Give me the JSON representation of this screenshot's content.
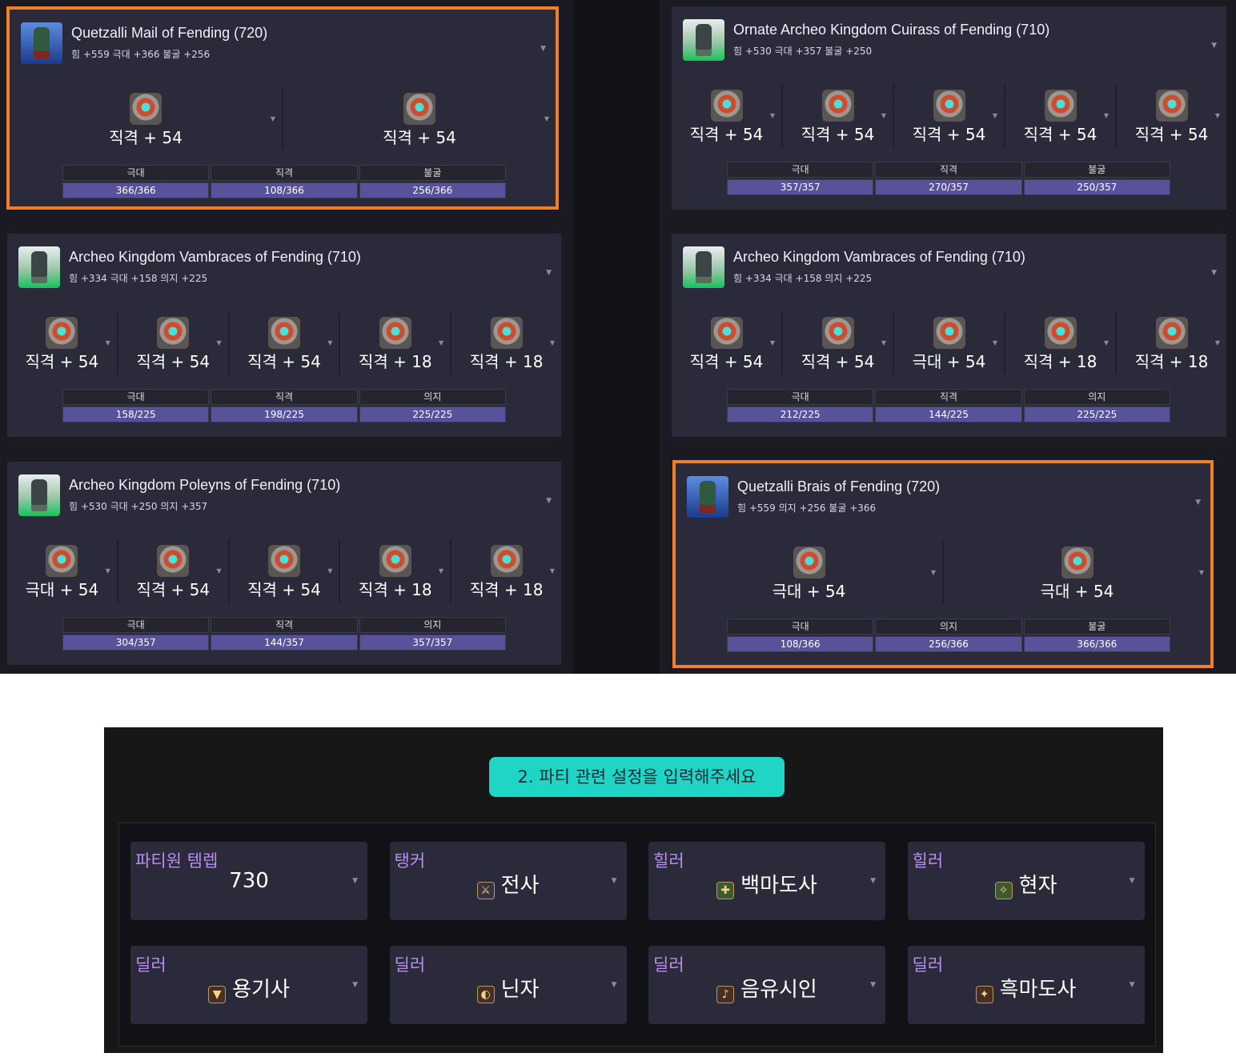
{
  "gear": [
    {
      "name": "Quetzalli Mail of Fending (720)",
      "stats": "힘 +559 극대 +366 불굴 +256",
      "icon": "blue",
      "highlight": true,
      "melds": [
        "직격 + 54",
        "직격 + 54"
      ],
      "table": {
        "headers": [
          "극대",
          "직격",
          "불굴"
        ],
        "values": [
          "366/366",
          "108/366",
          "256/366"
        ]
      }
    },
    {
      "name": "Ornate Archeo Kingdom Cuirass of Fending (710)",
      "stats": "힘 +530 극대 +357 불굴 +250",
      "icon": "green",
      "highlight": false,
      "melds": [
        "직격 + 54",
        "직격 + 54",
        "직격 + 54",
        "직격 + 54",
        "직격 + 54"
      ],
      "table": {
        "headers": [
          "극대",
          "직격",
          "불굴"
        ],
        "values": [
          "357/357",
          "270/357",
          "250/357"
        ]
      }
    },
    {
      "name": "Archeo Kingdom Vambraces of Fending (710)",
      "stats": "힘 +334 극대 +158 의지 +225",
      "icon": "green",
      "highlight": false,
      "melds": [
        "직격 + 54",
        "직격 + 54",
        "직격 + 54",
        "직격 + 18",
        "직격 + 18"
      ],
      "table": {
        "headers": [
          "극대",
          "직격",
          "의지"
        ],
        "values": [
          "158/225",
          "198/225",
          "225/225"
        ]
      }
    },
    {
      "name": "Archeo Kingdom Vambraces of Fending (710)",
      "stats": "힘 +334 극대 +158 의지 +225",
      "icon": "green",
      "highlight": false,
      "melds": [
        "직격 + 54",
        "직격 + 54",
        "극대 + 54",
        "직격 + 18",
        "직격 + 18"
      ],
      "table": {
        "headers": [
          "극대",
          "직격",
          "의지"
        ],
        "values": [
          "212/225",
          "144/225",
          "225/225"
        ]
      }
    },
    {
      "name": "Archeo Kingdom Poleyns of Fending (710)",
      "stats": "힘 +530 극대 +250 의지 +357",
      "icon": "green",
      "highlight": false,
      "melds": [
        "극대 + 54",
        "직격 + 54",
        "직격 + 54",
        "직격 + 18",
        "직격 + 18"
      ],
      "table": {
        "headers": [
          "극대",
          "직격",
          "의지"
        ],
        "values": [
          "304/357",
          "144/357",
          "357/357"
        ]
      }
    },
    {
      "name": "Quetzalli Brais of Fending (720)",
      "stats": "힘 +559 의지 +256 불굴 +366",
      "icon": "blue",
      "highlight": true,
      "melds": [
        "극대 + 54",
        "극대 + 54"
      ],
      "table": {
        "headers": [
          "극대",
          "의지",
          "불굴"
        ],
        "values": [
          "108/366",
          "256/366",
          "366/366"
        ]
      }
    }
  ],
  "party": {
    "title": "2. 파티 관련 설정을 입력해주세요",
    "slots": [
      {
        "role": "파티원 템렙",
        "value": "730",
        "icon": ""
      },
      {
        "role": "탱커",
        "value": "전사",
        "icon": "warrior-icon"
      },
      {
        "role": "힐러",
        "value": "백마도사",
        "icon": "white-mage-icon"
      },
      {
        "role": "힐러",
        "value": "현자",
        "icon": "sage-icon"
      },
      {
        "role": "딜러",
        "value": "용기사",
        "icon": "dragoon-icon"
      },
      {
        "role": "딜러",
        "value": "닌자",
        "icon": "ninja-icon"
      },
      {
        "role": "딜러",
        "value": "음유시인",
        "icon": "bard-icon"
      },
      {
        "role": "딜러",
        "value": "흑마도사",
        "icon": "black-mage-icon"
      }
    ]
  },
  "colors": {
    "accent": "#f07f27",
    "title_bg": "#1fd5c6",
    "role_text": "#b98df5",
    "stat_bar": "#57529a",
    "panel": "#2b2a3a"
  }
}
